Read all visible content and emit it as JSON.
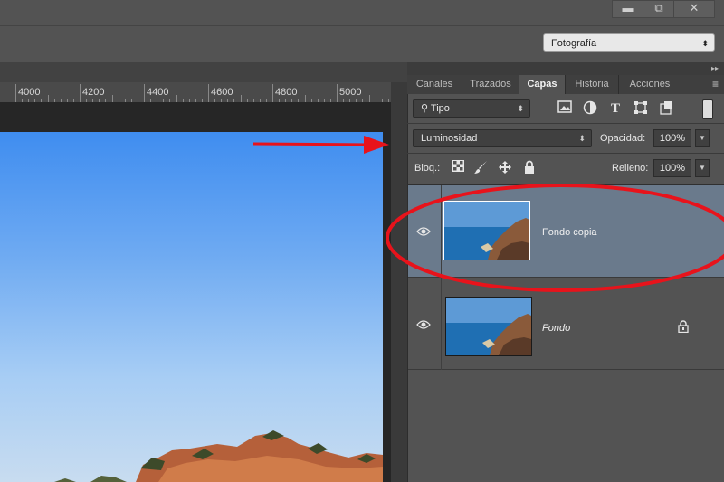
{
  "workspace": {
    "selected": "Fotografía"
  },
  "window_controls": {
    "minimize": "▬",
    "restore": "⧉",
    "close": "✕"
  },
  "ruler": {
    "labels": [
      "4000",
      "4200",
      "4400",
      "4600",
      "4800",
      "5000"
    ]
  },
  "panel": {
    "tabs": [
      {
        "label": "Canales"
      },
      {
        "label": "Trazados"
      },
      {
        "label": "Capas",
        "active": true
      },
      {
        "label": "Historia"
      },
      {
        "label": "Acciones"
      }
    ],
    "collapse_glyph": "▸▸",
    "menu_glyph": "≡",
    "filter": {
      "label": "Tipo",
      "search_glyph": "⚲"
    },
    "blend_mode": "Luminosidad",
    "opacity": {
      "label": "Opacidad:",
      "value": "100%"
    },
    "lock": {
      "label": "Bloq.:"
    },
    "fill": {
      "label": "Relleno:",
      "value": "100%"
    }
  },
  "layers": [
    {
      "name": "Fondo copia",
      "selected": true,
      "italic": false,
      "locked": false
    },
    {
      "name": "Fondo",
      "selected": false,
      "italic": true,
      "locked": true
    }
  ],
  "annotation": {
    "color": "#e8131b"
  },
  "colors": {
    "panel": "#535353",
    "selected_layer": "#6a7a8c",
    "sky_top": "#3f8df0",
    "sky_bottom": "#c8dcf0"
  }
}
